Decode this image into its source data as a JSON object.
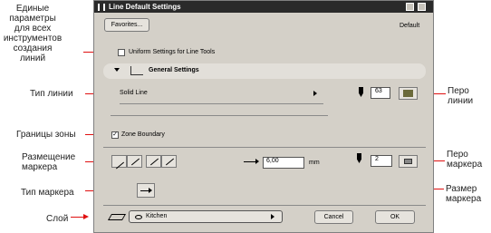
{
  "annotations": {
    "left": [
      "Единые\nпараметры\nдля всех\nинструментов\nсоздания линий",
      "Тип линии",
      "Границы зоны",
      "Размещение\nмаркера",
      "Тип маркера",
      "Слой"
    ],
    "right": [
      "Перо\nлинии",
      "Перо\nмаркера",
      "Размер\nмаркера"
    ]
  },
  "dialog": {
    "title": "Line Default Settings",
    "favorites_label": "Favorites...",
    "default_label": "Default",
    "uniform_label": "Uniform Settings for Line Tools",
    "section_title": "General Settings",
    "line_type_value": "Solid Line",
    "line_pen_value": "63",
    "zone_boundary_label": "Zone Boundary",
    "zone_boundary_checked": "✓",
    "marker_size_value": "6,00",
    "marker_size_unit": "mm",
    "marker_pen_value": "2",
    "layer_value": "Kitchen",
    "cancel_label": "Cancel",
    "ok_label": "OK"
  },
  "colors": {
    "accent_arrow": "#e01010",
    "pen_color": "#6b6a3a"
  },
  "icons": [
    "layer-eye-icon",
    "marker-symbol-icon",
    "pen-icon",
    "line-type-icon"
  ]
}
